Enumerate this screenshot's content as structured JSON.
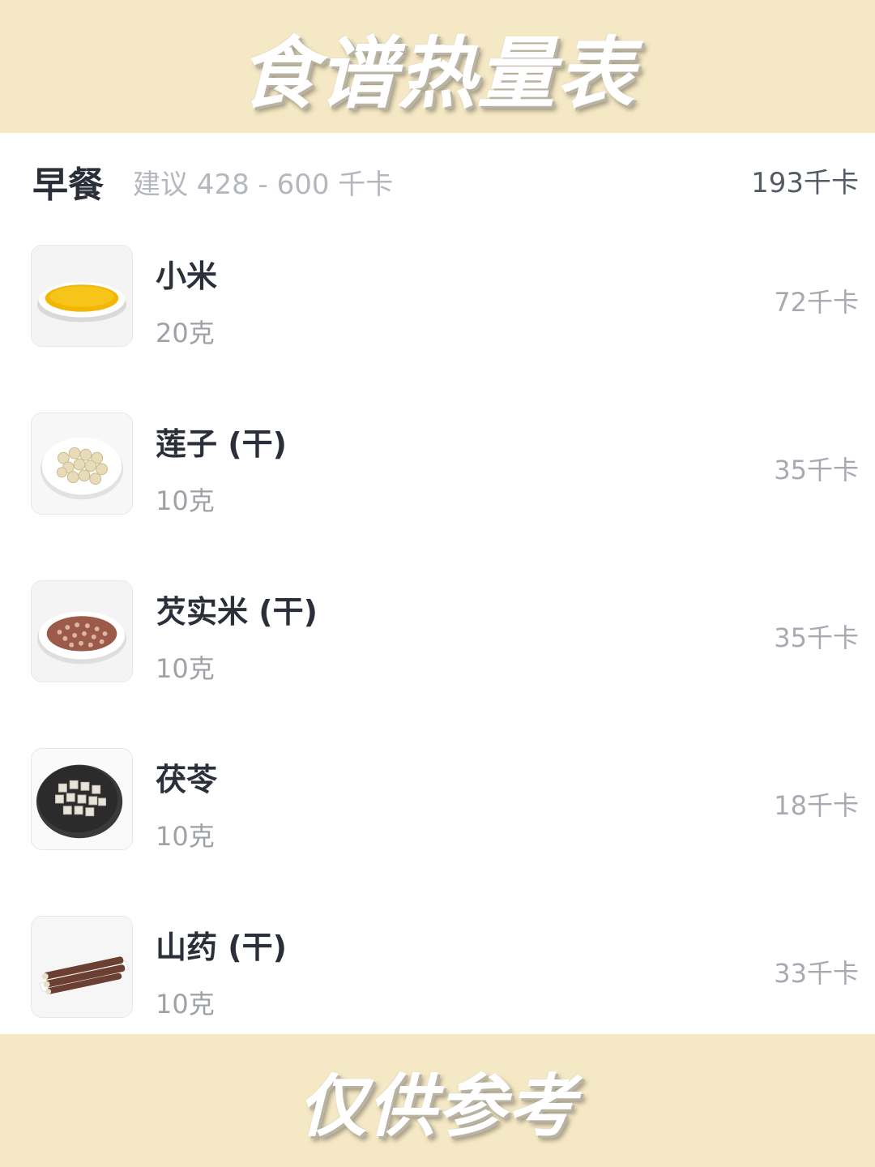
{
  "banner": {
    "title": "食谱热量表",
    "footer": "仅供参考"
  },
  "meal": {
    "name": "早餐",
    "suggestion": "建议 428 - 600 千卡",
    "total": "193千卡"
  },
  "items": [
    {
      "name": "小米",
      "amount": "20克",
      "calories": "72千卡",
      "icon": "millet-plate-icon"
    },
    {
      "name": "莲子 (干)",
      "amount": "10克",
      "calories": "35千卡",
      "icon": "lotus-seed-plate-icon"
    },
    {
      "name": "芡实米 (干)",
      "amount": "10克",
      "calories": "35千卡",
      "icon": "euryale-seed-plate-icon"
    },
    {
      "name": "茯苓",
      "amount": "10克",
      "calories": "18千卡",
      "icon": "poria-plate-icon"
    },
    {
      "name": "山药 (干)",
      "amount": "10克",
      "calories": "33千卡",
      "icon": "chinese-yam-plate-icon"
    }
  ]
}
